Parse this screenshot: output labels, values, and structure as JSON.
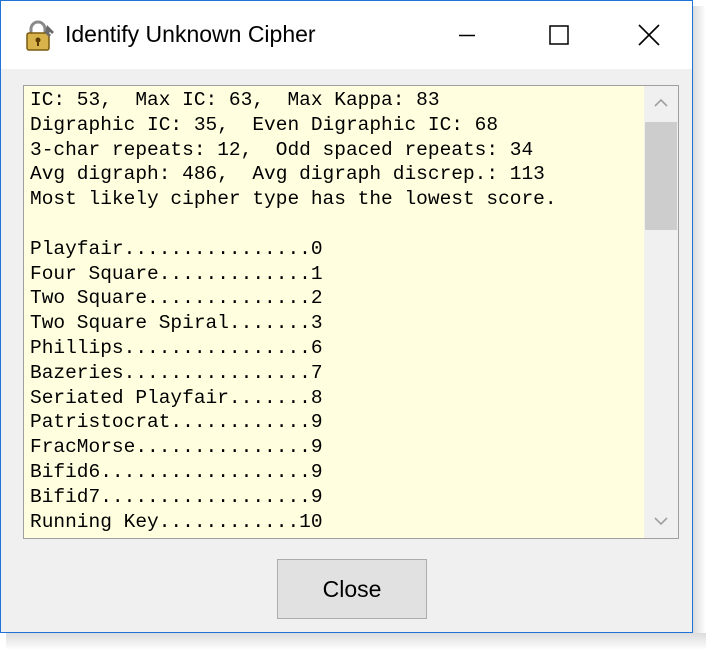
{
  "window": {
    "title": "Identify Unknown Cipher",
    "icon": "lock-key-icon"
  },
  "memo": {
    "lines": [
      "IC: 53,  Max IC: 63,  Max Kappa: 83",
      "Digraphic IC: 35,  Even Digraphic IC: 68",
      "3-char repeats: 12,  Odd spaced repeats: 34",
      "Avg digraph: 486,  Avg digraph discrep.: 113",
      "Most likely cipher type has the lowest score.",
      "",
      "Playfair................0",
      "Four Square.............1",
      "Two Square..............2",
      "Two Square Spiral.......3",
      "Phillips................6",
      "Bazeries................7",
      "Seriated Playfair.......8",
      "Patristocrat............9",
      "FracMorse...............9",
      "Bifid6..................9",
      "Bifid7..................9",
      "Running Key............10"
    ]
  },
  "buttons": {
    "close_label": "Close"
  }
}
